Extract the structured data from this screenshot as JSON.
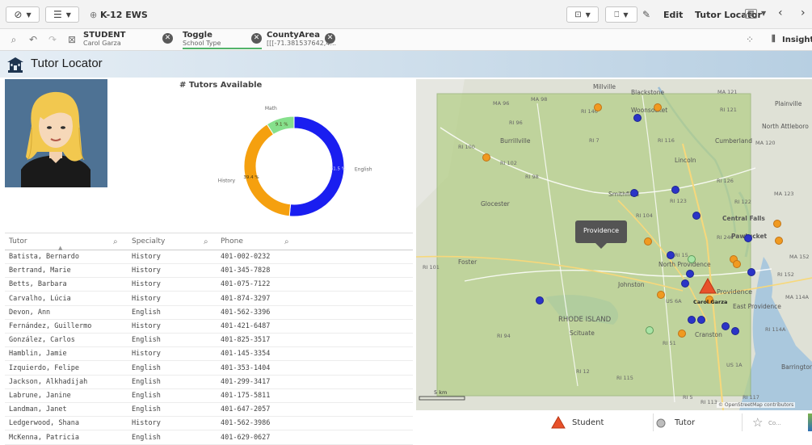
{
  "toolbar": {
    "app_name": "K-12 EWS",
    "edit_label": "Edit",
    "sheet_name": "Tutor Locator",
    "insights_label": "Insights"
  },
  "selections": [
    {
      "title": "STUDENT",
      "value": "Carol Garza"
    },
    {
      "title": "Toggle",
      "value": "School Type"
    },
    {
      "title": "CountyArea",
      "value": "[[[-71.381537642,4..."
    }
  ],
  "banner": {
    "title": "Tutor Locator"
  },
  "donut": {
    "title": "# Tutors Available",
    "colors": {
      "English": "#1a1ef0",
      "History": "#f5a00f",
      "Math": "#86e08c"
    }
  },
  "chart_data": {
    "type": "pie",
    "title": "# Tutors Available",
    "categories": [
      "English",
      "History",
      "Math"
    ],
    "values": [
      51.5,
      39.4,
      9.1
    ],
    "value_labels": [
      "51.5 %",
      "39.4 %",
      "9.1 %"
    ]
  },
  "table": {
    "columns": [
      "Tutor",
      "Specialty",
      "Phone"
    ],
    "rows": [
      [
        "Batista, Bernardo",
        "History",
        "401-002-0232"
      ],
      [
        "Bertrand, Marie",
        "History",
        "401-345-7828"
      ],
      [
        "Betts, Barbara",
        "History",
        "401-075-7122"
      ],
      [
        "Carvalho, Lúcia",
        "History",
        "401-874-3297"
      ],
      [
        "Devon, Ann",
        "English",
        "401-562-3396"
      ],
      [
        "Fernández, Guillermo",
        "History",
        "401-421-6487"
      ],
      [
        "González, Carlos",
        "English",
        "401-825-3517"
      ],
      [
        "Hamblin, Jamie",
        "History",
        "401-145-3354"
      ],
      [
        "Izquierdo, Felipe",
        "English",
        "401-353-1404"
      ],
      [
        "Jackson, Alkhadijah",
        "English",
        "401-299-3417"
      ],
      [
        "Labrune, Janine",
        "English",
        "401-175-5811"
      ],
      [
        "Landman, Janet",
        "English",
        "401-647-2057"
      ],
      [
        "Ledgerwood, Shana",
        "History",
        "401-562-3986"
      ],
      [
        "McKenna, Patricia",
        "English",
        "401-629-0627"
      ]
    ]
  },
  "map": {
    "tooltip": "Providence",
    "student_label": "Carol Garza",
    "scale": "5 km",
    "attribution": "© OpenStreetMap contributors",
    "places": [
      "Millville",
      "Blackstone",
      "Woonsocket",
      "Plainville",
      "North Attleboro",
      "Burrillville",
      "Cumberland",
      "Lincoln",
      "Glocester",
      "Smithfield",
      "Central Falls",
      "Pawtucket",
      "Foster",
      "North Providence",
      "Johnston",
      "Providence",
      "East Providence",
      "RHODE ISLAND",
      "Scituate",
      "Cranston",
      "Barrington"
    ],
    "roads": [
      "MA 96",
      "MA 98",
      "RI 146",
      "RI 121",
      "MA 121",
      "RI 96",
      "RI 7",
      "RI 100",
      "RI 102",
      "RI 98",
      "RI 116",
      "RI 126",
      "RI 123",
      "RI 122",
      "MA 123",
      "MA 120",
      "RI 104",
      "RI 246",
      "RI 101",
      "RI 15",
      "US 6A",
      "MA 152",
      "RI 152",
      "MA 114A",
      "RI 94",
      "RI 12",
      "RI 115",
      "RI 51",
      "RI 114A",
      "US 1A",
      "RI 113",
      "RI 117",
      "RI 5"
    ]
  },
  "legend": {
    "items": [
      {
        "label": "Student",
        "icon": "triangle-icon"
      },
      {
        "label": "Tutor",
        "icon": "circle-icon"
      },
      {
        "label": "Co...",
        "icon": "star-icon"
      }
    ]
  }
}
